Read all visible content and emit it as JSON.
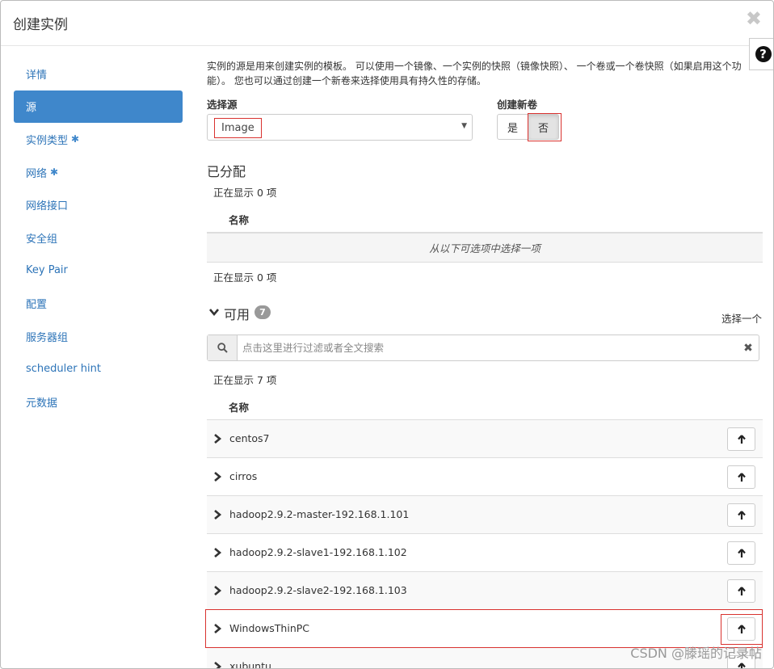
{
  "modal": {
    "title": "创建实例",
    "close_symbol": "✖",
    "help_symbol": "?"
  },
  "sidebar": {
    "items": [
      {
        "label": "详情",
        "required": false,
        "active": false
      },
      {
        "label": "源",
        "required": false,
        "active": true
      },
      {
        "label": "实例类型",
        "required": true,
        "active": false
      },
      {
        "label": "网络",
        "required": true,
        "active": false
      },
      {
        "label": "网络接口",
        "required": false,
        "active": false
      },
      {
        "label": "安全组",
        "required": false,
        "active": false
      },
      {
        "label": "Key Pair",
        "required": false,
        "active": false
      },
      {
        "label": "配置",
        "required": false,
        "active": false
      },
      {
        "label": "服务器组",
        "required": false,
        "active": false
      },
      {
        "label": "scheduler hint",
        "required": false,
        "active": false
      },
      {
        "label": "元数据",
        "required": false,
        "active": false
      }
    ],
    "required_marker": "✱"
  },
  "source": {
    "intro": "实例的源是用来创建实例的模板。 可以使用一个镜像、一个实例的快照（镜像快照）、 一个卷或一个卷快照（如果启用这个功能）。 您也可以通过创建一个新卷来选择使用具有持久性的存储。",
    "select_label": "选择源",
    "select_value": "Image",
    "new_volume_label": "创建新卷",
    "toggle_yes": "是",
    "toggle_no": "否"
  },
  "allocated": {
    "title": "已分配",
    "showing_top": "正在显示 0 项",
    "column_name": "名称",
    "empty_message": "从以下可选项中选择一项",
    "showing_bottom": "正在显示 0 项"
  },
  "available": {
    "title": "可用",
    "count": "7",
    "select_one": "选择一个",
    "search_placeholder": "点击这里进行过滤或者全文搜索",
    "showing": "正在显示 7 项",
    "column_name": "名称",
    "rows": [
      {
        "name": "centos7"
      },
      {
        "name": "cirros"
      },
      {
        "name": "hadoop2.9.2-master-192.168.1.101"
      },
      {
        "name": "hadoop2.9.2-slave1-192.168.1.102"
      },
      {
        "name": "hadoop2.9.2-slave2-192.168.1.103"
      },
      {
        "name": "WindowsThinPC"
      },
      {
        "name": "xubuntu"
      }
    ]
  },
  "watermark": "CSDN @滕瑶的记录帖",
  "colors": {
    "accent": "#3f87cb",
    "link": "#2d74b8",
    "highlight": "#d9322f"
  }
}
